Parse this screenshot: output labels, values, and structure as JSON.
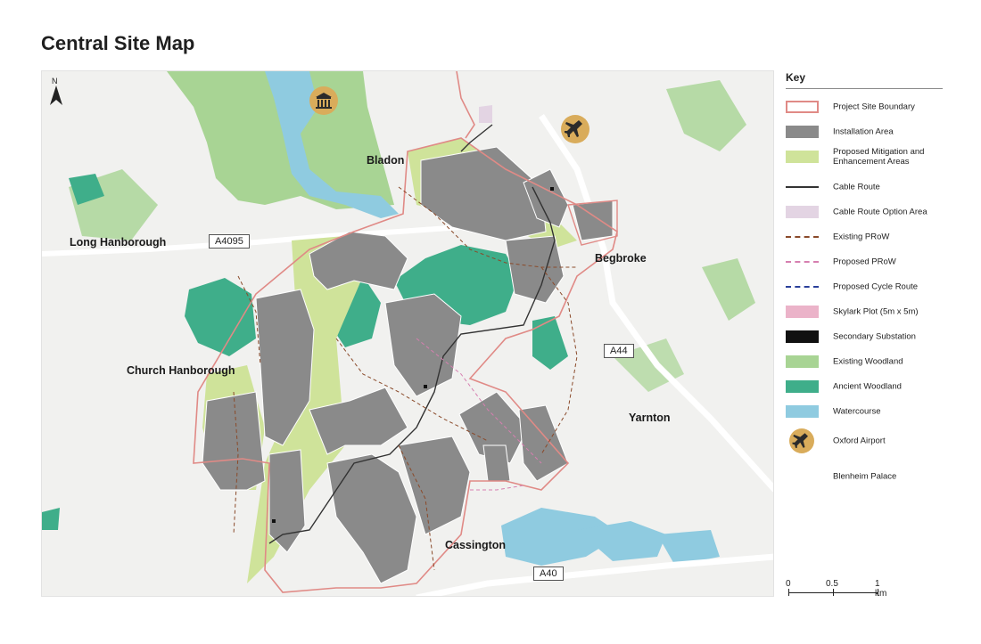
{
  "title": "Central Site Map",
  "map": {
    "places": {
      "bladon": "Bladon",
      "long_hanborough": "Long Hanborough",
      "begbroke": "Begbroke",
      "church_hanborough": "Church Hanborough",
      "yarnton": "Yarnton",
      "cassington": "Cassington"
    },
    "roads": {
      "a4095": "A4095",
      "a44": "A44",
      "a40": "A40"
    },
    "north_label": "N",
    "icons": {
      "palace": "blenheim-palace-icon",
      "airport": "airplane-icon",
      "north": "north-arrow-icon"
    }
  },
  "key": {
    "title": "Key",
    "items": [
      {
        "label": "Project Site Boundary",
        "swatch": "outline",
        "color": "#e08a86"
      },
      {
        "label": "Installation Area",
        "swatch": "fill",
        "color": "#8a8a8a"
      },
      {
        "label": "Proposed Mitigation and Enhancement Areas",
        "swatch": "fill",
        "color": "#cfe39a"
      },
      {
        "label": "Cable Route",
        "swatch": "line",
        "color": "#333333"
      },
      {
        "label": "Cable Route Option Area",
        "swatch": "fill",
        "color": "#e3d4e3"
      },
      {
        "label": "Existing PRoW",
        "swatch": "dash",
        "color": "#8a4a2a"
      },
      {
        "label": "Proposed PRoW",
        "swatch": "dash",
        "color": "#d67fb0"
      },
      {
        "label": "Proposed Cycle Route",
        "swatch": "dash",
        "color": "#2a3f9a"
      },
      {
        "label": "Skylark Plot (5m x 5m)",
        "swatch": "fill",
        "color": "#ebb3c9"
      },
      {
        "label": "Secondary Substation",
        "swatch": "fill",
        "color": "#111111"
      },
      {
        "label": "Existing Woodland",
        "swatch": "fill",
        "color": "#a8d494"
      },
      {
        "label": "Ancient Woodland",
        "swatch": "fill",
        "color": "#3fae8a"
      },
      {
        "label": "Watercourse",
        "swatch": "fill",
        "color": "#8fcbe0"
      },
      {
        "label": "Oxford Airport",
        "swatch": "airport",
        "color": "#d9ac5b"
      },
      {
        "label": "Blenheim Palace",
        "swatch": "none",
        "color": ""
      }
    ]
  },
  "scale_bar": {
    "labels": [
      "0",
      "0.5",
      "1 km"
    ]
  }
}
